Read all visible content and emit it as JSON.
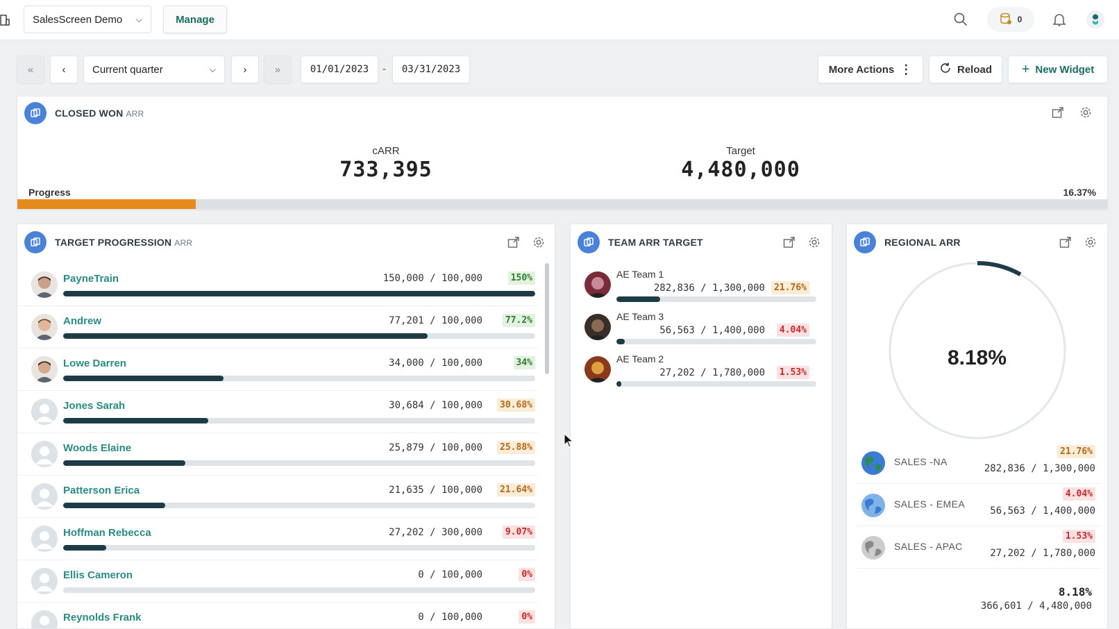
{
  "topbar": {
    "app_name": "SalesScreen Demo",
    "manage_label": "Manage",
    "coins_count": "0"
  },
  "toolbar": {
    "period_label": "Current quarter",
    "date_from": "01/01/2023",
    "date_sep": "-",
    "date_to": "03/31/2023",
    "more_actions": "More Actions",
    "reload": "Reload",
    "new_widget": "New Widget"
  },
  "closed_won": {
    "title": "CLOSED WON",
    "subtitle": "ARR",
    "carr_label": "cARR",
    "carr_value": "733,395",
    "target_label": "Target",
    "target_value": "4,480,000",
    "progress_label": "Progress",
    "progress_pct": "16.37%",
    "progress_fraction": 0.1637
  },
  "target_progression": {
    "title": "TARGET PROGRESSION",
    "subtitle": "ARR",
    "rows": [
      {
        "name": "PayneTrain",
        "values": "150,000 / 100,000",
        "pct": "150%",
        "fraction": 1.0,
        "level": "ok"
      },
      {
        "name": "Andrew",
        "values": "77,201 / 100,000",
        "pct": "77.2%",
        "fraction": 0.772,
        "level": "ok"
      },
      {
        "name": "Lowe Darren",
        "values": "34,000 / 100,000",
        "pct": "34%",
        "fraction": 0.34,
        "level": "ok"
      },
      {
        "name": "Jones Sarah",
        "values": "30,684 / 100,000",
        "pct": "30.68%",
        "fraction": 0.3068,
        "level": "mid"
      },
      {
        "name": "Woods Elaine",
        "values": "25,879 / 100,000",
        "pct": "25.88%",
        "fraction": 0.2588,
        "level": "mid"
      },
      {
        "name": "Patterson Erica",
        "values": "21,635 / 100,000",
        "pct": "21.64%",
        "fraction": 0.2164,
        "level": "mid"
      },
      {
        "name": "Hoffman Rebecca",
        "values": "27,202 / 300,000",
        "pct": "9.07%",
        "fraction": 0.0907,
        "level": "low"
      },
      {
        "name": "Ellis Cameron",
        "values": "0 / 100,000",
        "pct": "0%",
        "fraction": 0.0,
        "level": "low"
      },
      {
        "name": "Reynolds Frank",
        "values": "0 / 100,000",
        "pct": "0%",
        "fraction": 0.0,
        "level": "low"
      }
    ]
  },
  "team_arr": {
    "title": "TEAM ARR TARGET",
    "rows": [
      {
        "name": "AE Team 1",
        "values": "282,836 / 1,300,000",
        "pct": "21.76%",
        "fraction": 0.2176,
        "level": "mid"
      },
      {
        "name": "AE Team 3",
        "values": "56,563 / 1,400,000",
        "pct": "4.04%",
        "fraction": 0.0404,
        "level": "low"
      },
      {
        "name": "AE Team 2",
        "values": "27,202 / 1,780,000",
        "pct": "1.53%",
        "fraction": 0.0153,
        "level": "low"
      }
    ]
  },
  "regional_arr": {
    "title": "REGIONAL ARR",
    "gauge_pct": "8.18%",
    "gauge_fraction": 0.0818,
    "rows": [
      {
        "name": "SALES -NA",
        "pct": "21.76%",
        "values": "282,836 / 1,300,000",
        "level": "mid"
      },
      {
        "name": "SALES - EMEA",
        "pct": "4.04%",
        "values": "56,563 / 1,400,000",
        "level": "low"
      },
      {
        "name": "SALES - APAC",
        "pct": "1.53%",
        "values": "27,202 / 1,780,000",
        "level": "low"
      }
    ],
    "total_pct": "8.18%",
    "total_values": "366,601 / 4,480,000"
  },
  "colors": {
    "accent": "#1a6b66",
    "progress_orange": "#e68a1e",
    "bar_dark": "#1d3c48",
    "icon_blue": "#4a82d9"
  }
}
